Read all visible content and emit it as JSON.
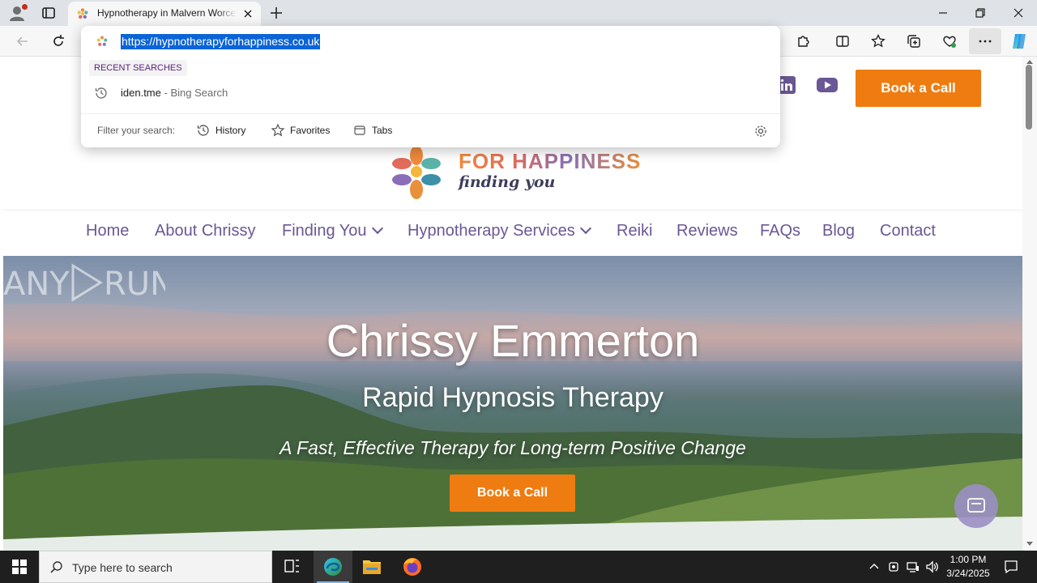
{
  "browser": {
    "tab_title": "Hypnotherapy in Malvern Worcestershire",
    "address_url": "https://hypnotherapyforhappiness.co.uk"
  },
  "omnibox": {
    "section_label": "RECENT SEARCHES",
    "history_item": {
      "query": "iden.tme",
      "separator": " - ",
      "source": "Bing Search"
    },
    "filter_label": "Filter your search:",
    "filters": [
      "History",
      "Favorites",
      "Tabs"
    ]
  },
  "site": {
    "header_button": "Book a Call",
    "logo_text": "FOR HAPPINESS",
    "logo_tagline": "finding you",
    "nav": [
      "Home",
      "About Chrissy",
      "Finding You",
      "Hypnotherapy Services",
      "Reiki",
      "Reviews",
      "FAQs",
      "Blog",
      "Contact"
    ],
    "hero": {
      "title": "Chrissy Emmerton",
      "subtitle": "Rapid Hypnosis Therapy",
      "tagline": "A Fast, Effective Therapy for Long-term Positive Change",
      "button": "Book a Call"
    },
    "watermark": "ANY RUN"
  },
  "taskbar": {
    "search_placeholder": "Type here to search",
    "time": "1:00 PM",
    "date": "3/24/2025"
  },
  "colors": {
    "accent_orange": "#ef7c10",
    "nav_purple": "#6a5795",
    "selection_blue": "#0a64d6"
  }
}
